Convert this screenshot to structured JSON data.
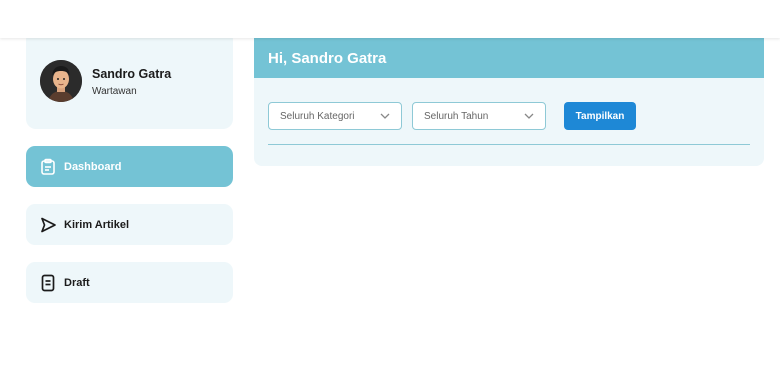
{
  "user": {
    "name": "Sandro Gatra",
    "role": "Wartawan"
  },
  "sidebar": {
    "items": [
      {
        "label": "Dashboard",
        "icon": "clipboard-icon",
        "active": true
      },
      {
        "label": "Kirim Artikel",
        "icon": "send-icon",
        "active": false
      },
      {
        "label": "Draft",
        "icon": "document-icon",
        "active": false
      }
    ]
  },
  "main": {
    "greeting": "Hi, Sandro Gatra",
    "filters": {
      "category": {
        "selected": "Seluruh Kategori"
      },
      "year": {
        "selected": "Seluruh Tahun"
      }
    },
    "show_button": "Tampilkan"
  },
  "colors": {
    "accent": "#74c3d5",
    "panel_bg": "#eef7fa",
    "button": "#1e88d6"
  }
}
